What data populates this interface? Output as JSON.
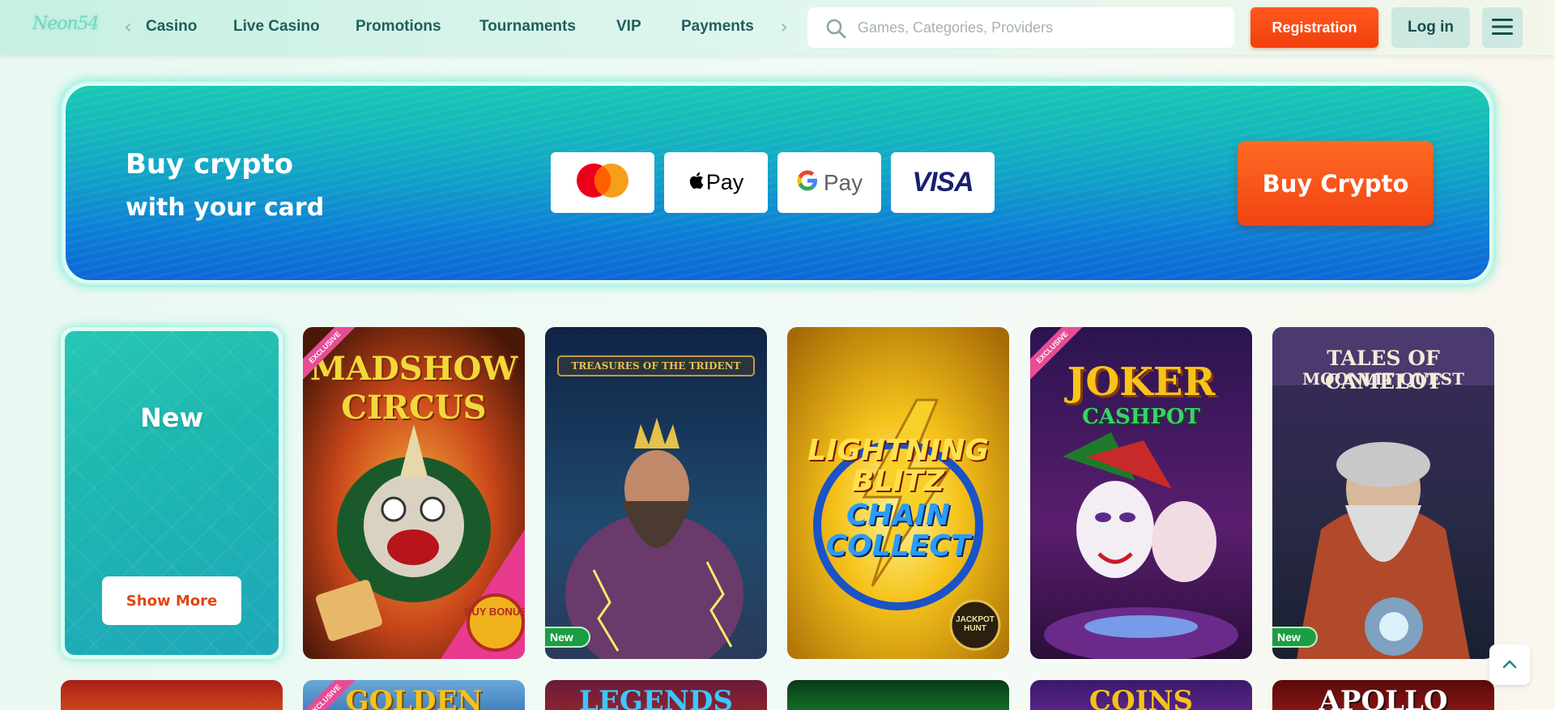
{
  "header": {
    "logo_text": "Neon54",
    "nav": [
      "Casino",
      "Live Casino",
      "Promotions",
      "Tournaments",
      "VIP",
      "Payments"
    ],
    "search_placeholder": "Games, Categories, Providers",
    "registration_label": "Registration",
    "login_label": "Log in"
  },
  "banner": {
    "title_line1": "Buy crypto",
    "title_line2": "with your card",
    "payment_methods": [
      "mastercard",
      "Apple Pay",
      "Google Pay",
      "VISA"
    ],
    "apple_pay_label": "Pay",
    "google_pay_label": "Pay",
    "visa_label": "VISA",
    "cta_label": "Buy Crypto"
  },
  "games": {
    "new_tile_label": "New",
    "show_more_label": "Show More",
    "cards": [
      {
        "title_l1": "MADSHOW",
        "title_l2": "CIRCUS",
        "badge": "EXCLUSIVE",
        "corner": "BUY BONUS"
      },
      {
        "title_l1": "TREASURES OF THE TRIDENT",
        "badge": "New"
      },
      {
        "title_l1": "LIGHTNING",
        "title_l2": "BLITZ",
        "title_l3": "CHAIN",
        "title_l4": "COLLECT",
        "corner": "JACKPOT HUNT"
      },
      {
        "title_l1": "JOKER",
        "title_l2": "CASHPOT",
        "badge": "EXCLUSIVE"
      },
      {
        "title_l1": "TALES OF CAMELOT",
        "title_l2": "MOONLIT QUEST",
        "badge": "New"
      }
    ],
    "row2": [
      "",
      "GOLDEN",
      "LEGENDS",
      "",
      "COINS",
      "APOLLO"
    ],
    "row2_badge": "EXCLUSIVE"
  },
  "colors": {
    "accent_orange": "#f13e0c",
    "teal": "#1eb7b1",
    "nav_text": "#1f5f5b"
  }
}
